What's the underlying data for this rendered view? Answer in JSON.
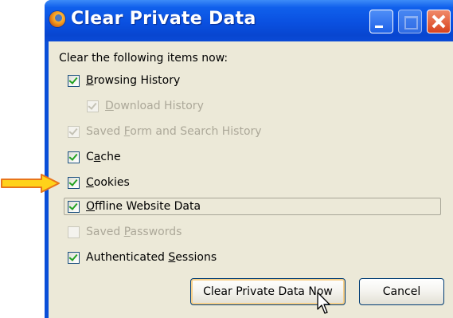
{
  "window": {
    "title": "Clear Private Data"
  },
  "dialog": {
    "instruction": "Clear the following items now:",
    "items": [
      {
        "pre": "",
        "accel": "B",
        "post": "rowsing History",
        "checked": true,
        "enabled": true
      },
      {
        "pre": "",
        "accel": "D",
        "post": "ownload History",
        "checked": true,
        "enabled": false
      },
      {
        "pre": "Saved ",
        "accel": "F",
        "post": "orm and Search History",
        "checked": true,
        "enabled": false
      },
      {
        "pre": "C",
        "accel": "a",
        "post": "che",
        "checked": true,
        "enabled": true
      },
      {
        "pre": "",
        "accel": "C",
        "post": "ookies",
        "checked": true,
        "enabled": true
      },
      {
        "pre": "",
        "accel": "O",
        "post": "ffline Website Data",
        "checked": true,
        "enabled": true
      },
      {
        "pre": "Saved ",
        "accel": "P",
        "post": "asswords",
        "checked": false,
        "enabled": false
      },
      {
        "pre": "Authenticated ",
        "accel": "S",
        "post": "essions",
        "checked": true,
        "enabled": true
      }
    ],
    "buttons": {
      "clear_now": "Clear Private Data Now",
      "cancel": "Cancel"
    }
  },
  "colors": {
    "titlebar": "#0a50e0",
    "dialog_bg": "#ece9d8",
    "arrow_fill": "#ffd21a",
    "arrow_stroke": "#e8741a",
    "checkmark": "#21a121"
  },
  "icons": {
    "app": "firefox-icon",
    "annotation": "arrow-right-icon",
    "pointer": "mouse-cursor-icon"
  }
}
